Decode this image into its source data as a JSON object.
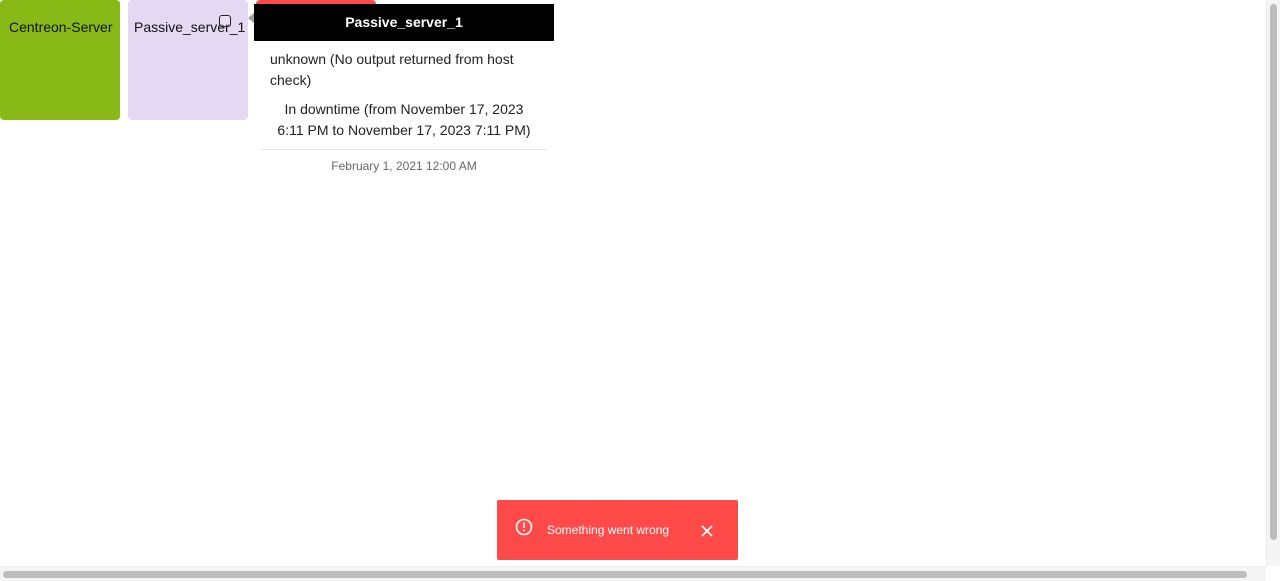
{
  "tiles": {
    "centreon_server": {
      "label": "Centreon-Server",
      "color": "#88b917"
    },
    "passive_server": {
      "label": "Passive_server_1",
      "color": "#e5d8f3"
    },
    "third_tile": {
      "color": "#ff4a4a"
    }
  },
  "icons": {
    "acknowledge": "acknowledge-icon",
    "snackbar_alert": "alert-circle-icon",
    "snackbar_close": "close-icon"
  },
  "tooltip": {
    "title": "Passive_server_1",
    "status": "unknown (No output returned from host check)",
    "downtime": "In downtime (from November 17, 2023 6:11 PM to November 17, 2023 7:11 PM)",
    "last_check": "February 1, 2021 12:00 AM"
  },
  "snackbar": {
    "message": "Something went wrong",
    "color": "#ff4a4a"
  }
}
